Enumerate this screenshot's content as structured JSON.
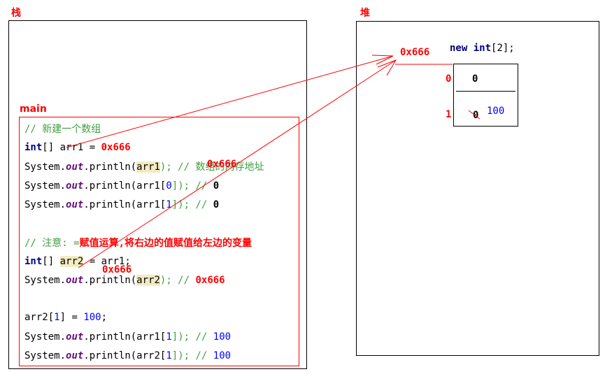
{
  "stack": {
    "title": "栈"
  },
  "heap": {
    "title": "堆"
  },
  "main": {
    "label": "main"
  },
  "code": {
    "line1": "// 新建一个数组",
    "line2": {
      "kw": "int",
      "rest": "[] arr1 = ",
      "value": "0x666"
    },
    "line3": {
      "prefix": "System.",
      "out": "out",
      "mid": ".println(",
      "hl": "arr1",
      "end": "); // 数组的内存地址"
    },
    "line4": {
      "prefix": "System.",
      "out": "out",
      "mid": ".println(arr1[",
      "idx": "0",
      "end": "]); // ",
      "result": "0"
    },
    "line5": {
      "prefix": "System.",
      "out": "out",
      "mid": ".println(arr1[",
      "idx": "1",
      "end": "]); // ",
      "result": "0"
    },
    "line6": {
      "cmt": "// 注意: =",
      "red": "赋值运算,将右边的值赋值给左边的变量"
    },
    "line7": {
      "kw": "int",
      "rest": "[] ",
      "hl": "arr2",
      "end": " = arr1;"
    },
    "line8": {
      "prefix": "System.",
      "out": "out",
      "mid": ".println(",
      "hl": "arr2",
      "end": "); // ",
      "result": "0x666"
    },
    "line9": {
      "pre": "arr2[",
      "idx": "1",
      "mid": "] = ",
      "val": "100",
      "end": ";"
    },
    "line10": {
      "prefix": "System.",
      "out": "out",
      "mid": ".println(arr1[",
      "idx": "1",
      "end": "]); // ",
      "result": "100"
    },
    "line11": {
      "prefix": "System.",
      "out": "out",
      "mid": ".println(arr2[",
      "idx": "1",
      "end": "]); // ",
      "result": "100"
    }
  },
  "annotations": {
    "addr_line3": "0x666",
    "addr_arr2": "0x666"
  },
  "heap_array": {
    "address": "0x666",
    "decl_kw": "new int",
    "decl_rest": "[2];",
    "indices": [
      "0",
      "1"
    ],
    "cell0": "0",
    "cell1_old": "0",
    "cell1_new": "100"
  },
  "colors": {
    "accent": "#ff0000",
    "keyword": "#000080",
    "number": "#0000ff",
    "highlight": "#f2ebc2"
  }
}
